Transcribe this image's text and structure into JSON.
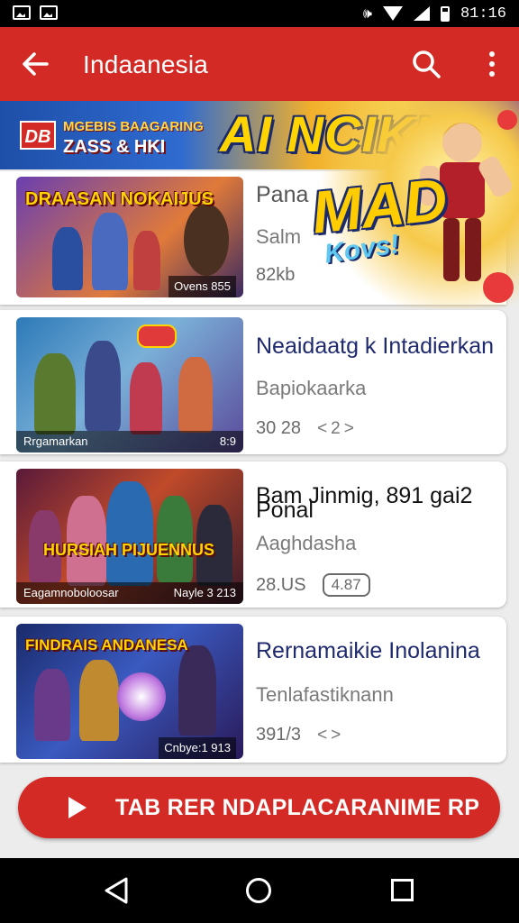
{
  "status_bar": {
    "time": "81:16"
  },
  "app_bar": {
    "title": "Indaanesia"
  },
  "banner": {
    "logo": "DB",
    "line1": "MGEBIS BAAGARING",
    "line2": "ZASS & HKI",
    "headline": "AI NCIKI"
  },
  "featured_art": {
    "headline": "MAD",
    "sub": "Kovs!"
  },
  "cards": [
    {
      "title": "Pana",
      "subtitle": "Salm",
      "meta": "82kb",
      "thumb_title": "DRAASAN NOKAIJUS",
      "thumb_label_right": "Ovens 855",
      "thumb_label_left": ""
    },
    {
      "title": "Neaidaatg k Intadierkan",
      "subtitle": "Bapiokaarka",
      "meta": "30 28",
      "chip": "<2>",
      "thumb_title": "",
      "thumb_label_left": "Rrgamarkan",
      "thumb_label_right": "8:9"
    },
    {
      "title": "Bam Jinmig, 891 gai2",
      "title_overlap": "Ponal",
      "subtitle": "Aaghdasha",
      "meta": "28.US",
      "chip": "4.87",
      "thumb_title": "HURSIAH PIJUENNUS",
      "thumb_label_left": "Eagamnoboloosar",
      "thumb_label_right": "Nayle 3 213"
    },
    {
      "title": "Rernamaikie Inolanina",
      "subtitle": "Tenlafastiknann",
      "meta": "391/3",
      "chip": "<>",
      "thumb_title": "FINDRAIS ANDANESA",
      "thumb_label_left": "",
      "thumb_label_right": "Cnbye:1 913"
    }
  ],
  "cta": {
    "label": "TAB RER NDAPLACARANIME RP"
  },
  "colors": {
    "primary": "#d42a25",
    "title_text": "#1f2a6e"
  }
}
